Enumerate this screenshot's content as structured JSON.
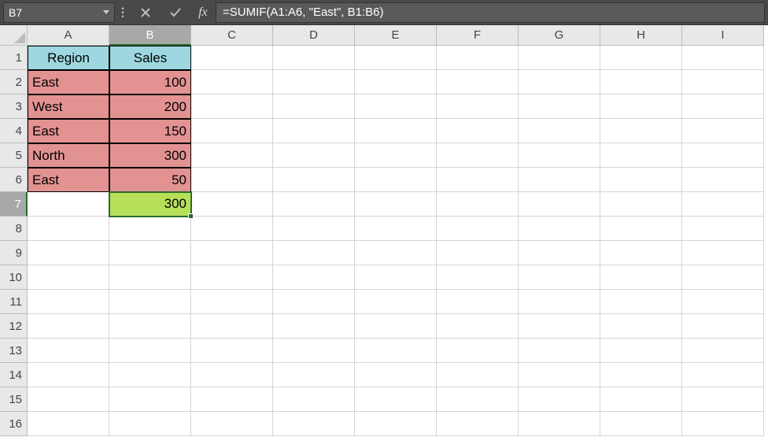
{
  "namebox": "B7",
  "formula": "=SUMIF(A1:A6, \"East\", B1:B6)",
  "fx_label": "fx",
  "columns": [
    "A",
    "B",
    "C",
    "D",
    "E",
    "F",
    "G",
    "H",
    "I"
  ],
  "selected_col": "B",
  "rows": [
    "1",
    "2",
    "3",
    "4",
    "5",
    "6",
    "7",
    "8",
    "9",
    "10",
    "11",
    "12",
    "13",
    "14",
    "15",
    "16"
  ],
  "selected_row": "7",
  "cells": {
    "A1": "Region",
    "B1": "Sales",
    "A2": "East",
    "B2": "100",
    "A3": "West",
    "B3": "200",
    "A4": "East",
    "B4": "150",
    "A5": "North",
    "B5": "300",
    "A6": "East",
    "B6": "50",
    "B7": "300"
  },
  "chart_data": {
    "type": "table",
    "columns": [
      "Region",
      "Sales"
    ],
    "rows": [
      [
        "East",
        100
      ],
      [
        "West",
        200
      ],
      [
        "East",
        150
      ],
      [
        "North",
        300
      ],
      [
        "East",
        50
      ]
    ],
    "computed": {
      "cell": "B7",
      "formula": "=SUMIF(A1:A6, \"East\", B1:B6)",
      "value": 300
    }
  }
}
